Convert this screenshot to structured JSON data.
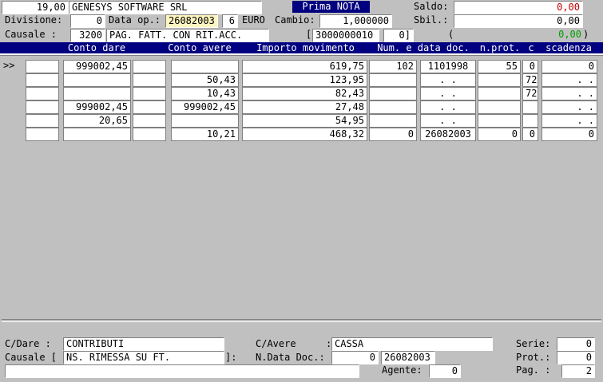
{
  "header": {
    "code": "19,00",
    "company": "GENESYS SOFTWARE SRL",
    "title": "Prima NOTA",
    "saldo_label": "Saldo:",
    "saldo_value": "0,00",
    "divisione_label": "Divisione:",
    "divisione_value": "0",
    "data_op_label": "Data op.:",
    "data_op_value": "26082003",
    "data_op_extra": "6",
    "euro_label": "EURO",
    "cambio_label": "Cambio:",
    "cambio_value": "1,000000",
    "sbil_label": "Sbil.:",
    "sbil_value": "0,00",
    "causale_label": "Causale  :",
    "causale_code": "3200",
    "causale_desc": "PAG. FATT. CON RIT.ACC.",
    "bracket_open": "[",
    "ref_value": "3000000010",
    "ref_extra": "0]",
    "paren_open": "(",
    "green_value": "0,00",
    "paren_close": ")"
  },
  "columns": {
    "conto_dare": "Conto dare",
    "conto_avere": "Conto avere",
    "importo": "Importo movimento",
    "num_data": "Num. e data doc.",
    "nprot": "n.prot.",
    "c": "c",
    "scadenza": "scadenza"
  },
  "rows": [
    {
      "marker": ">>",
      "dare": "999002,45",
      "avere": "",
      "importo": "619,75",
      "num": "102",
      "data": "1101998",
      "prot": "55",
      "c": "0",
      "scad": "0"
    },
    {
      "marker": "",
      "dare": "",
      "avere": "50,43",
      "importo": "123,95",
      "num": "",
      "data": ". .",
      "prot": "",
      "c": "72",
      "scad": ". ."
    },
    {
      "marker": "",
      "dare": "",
      "avere": "10,43",
      "importo": "82,43",
      "num": "",
      "data": ". .",
      "prot": "",
      "c": "72",
      "scad": ". ."
    },
    {
      "marker": "",
      "dare": "999002,45",
      "avere": "999002,45",
      "importo": "27,48",
      "num": "",
      "data": ". .",
      "prot": "",
      "c": "",
      "scad": ". ."
    },
    {
      "marker": "",
      "dare": "20,65",
      "avere": "",
      "importo": "54,95",
      "num": "",
      "data": ". .",
      "prot": "",
      "c": "",
      "scad": ". ."
    },
    {
      "marker": "",
      "dare": "",
      "avere": "10,21",
      "importo": "468,32",
      "num": "0",
      "data": "26082003",
      "prot": "0",
      "c": "0",
      "scad": "0"
    }
  ],
  "footer": {
    "cdare_label": "C/Dare  :",
    "cdare_value": "CONTRIBUTI",
    "cavere_label": "C/Avere",
    "cavere_colon": ":",
    "cavere_value": "CASSA",
    "serie_label": "Serie:",
    "serie_value": "0",
    "causale_label": "Causale [",
    "causale_value": "NS. RIMESSA SU FT.",
    "causale_close": "]:",
    "ndata_label": "N.Data Doc.:",
    "ndata_num": "0",
    "ndata_date": "26082003",
    "prot_label": "Prot.:",
    "prot_value": "0",
    "agente_label": "Agente:",
    "agente_value": "0",
    "pag_label": "Pag. :",
    "pag_value": "2"
  }
}
